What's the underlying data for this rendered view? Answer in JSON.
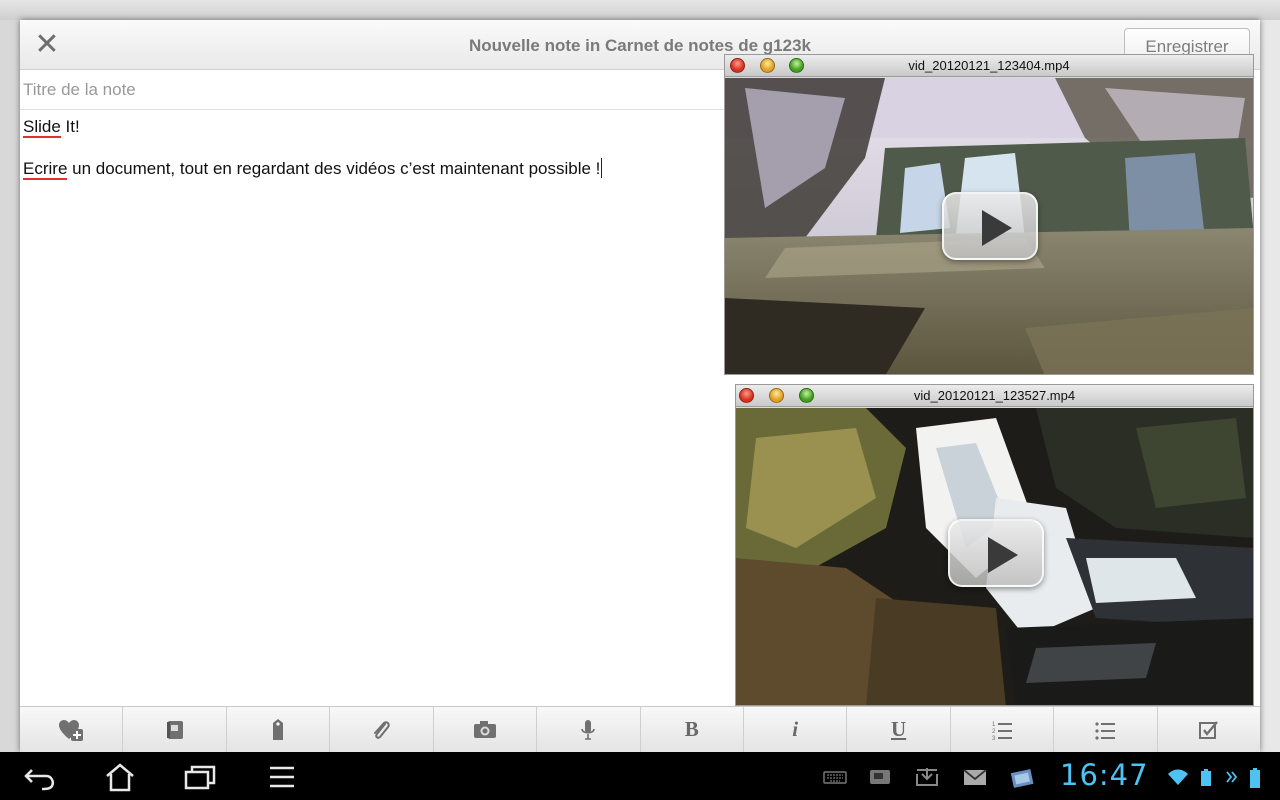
{
  "dialog": {
    "title": "Nouvelle note in Carnet de notes de g123k",
    "close_label": "✕",
    "save_label": "Enregistrer"
  },
  "note": {
    "title_placeholder": "Titre de la note",
    "title_value": "",
    "lines": [
      "Slide It!",
      "Ecrire un document, tout en regardant des vidéos c’est maintenant possible !"
    ]
  },
  "videos": [
    {
      "filename": "vid_20120121_123404.mp4"
    },
    {
      "filename": "vid_20120121_123527.mp4"
    }
  ],
  "toolbar": {
    "buttons": [
      {
        "icon": "add-to-favorites-icon"
      },
      {
        "icon": "notebook-icon"
      },
      {
        "icon": "tag-icon"
      },
      {
        "icon": "paperclip-icon"
      },
      {
        "icon": "camera-icon"
      },
      {
        "icon": "microphone-icon"
      },
      {
        "label": "B",
        "icon": "bold-icon"
      },
      {
        "label": "i",
        "icon": "italic-icon"
      },
      {
        "label": "U",
        "icon": "underline-icon"
      },
      {
        "icon": "numbered-list-icon"
      },
      {
        "icon": "bulleted-list-icon"
      },
      {
        "icon": "checkbox-icon"
      }
    ]
  },
  "statusbar": {
    "time": "16:47",
    "accent_color": "#4cc3f0"
  },
  "colors": {
    "spellcheck_underline": "#e03030"
  }
}
